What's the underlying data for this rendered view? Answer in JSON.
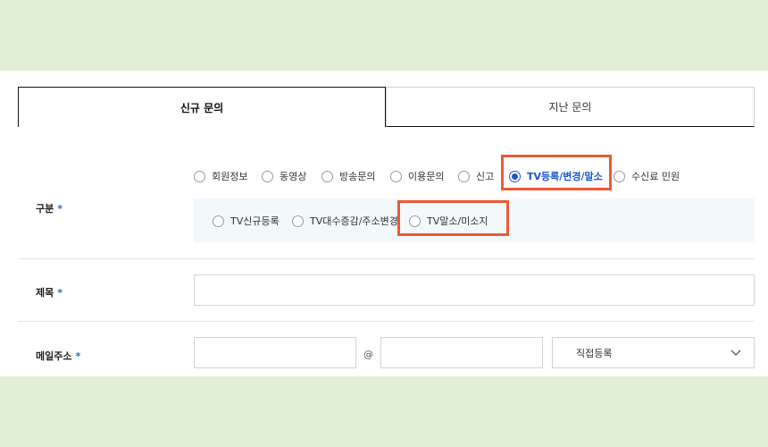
{
  "tabs": [
    {
      "label": "신규 문의",
      "active": true
    },
    {
      "label": "지난 문의",
      "active": false
    }
  ],
  "category": {
    "label": "구분",
    "required_mark": "*",
    "options": [
      "회원정보",
      "동영상",
      "방송문의",
      "이용문의",
      "신고",
      "TV등록/변경/말소",
      "수신료 민원"
    ],
    "selected": "TV등록/변경/말소",
    "sub_options": [
      "TV신규등록",
      "TV대수증감/주소변경",
      "TV말소/미소지"
    ]
  },
  "title_field": {
    "label": "제목",
    "required_mark": "*",
    "value": ""
  },
  "email": {
    "label": "메일주소",
    "required_mark": "*",
    "local_value": "",
    "at_symbol": "@",
    "domain_value": "",
    "domain_select": "직접등록"
  },
  "colors": {
    "accent": "#1e56c8",
    "highlight": "#ea5a35",
    "background": "#e2efd7"
  },
  "icons": {
    "select_arrow": "chevron-down-icon"
  }
}
